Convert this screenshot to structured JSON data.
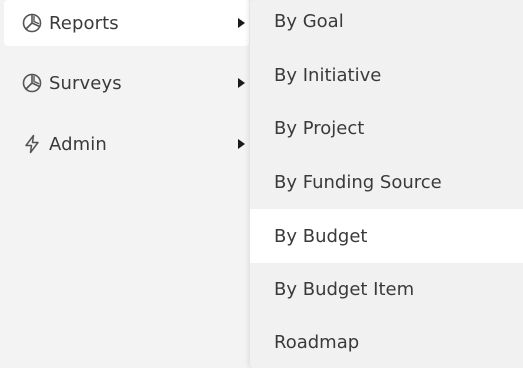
{
  "sidebar": {
    "items": [
      {
        "label": "Reports",
        "icon": "pie-chart-icon",
        "active": true
      },
      {
        "label": "Surveys",
        "icon": "pie-chart-icon",
        "active": false
      },
      {
        "label": "Admin",
        "icon": "lightning-icon",
        "active": false
      }
    ]
  },
  "submenu": {
    "items": [
      {
        "label": "By Goal"
      },
      {
        "label": "By Initiative"
      },
      {
        "label": "By Project"
      },
      {
        "label": "By Funding Source"
      },
      {
        "label": "By Budget",
        "highlighted": true
      },
      {
        "label": "By Budget Item"
      },
      {
        "label": "Roadmap"
      }
    ]
  }
}
